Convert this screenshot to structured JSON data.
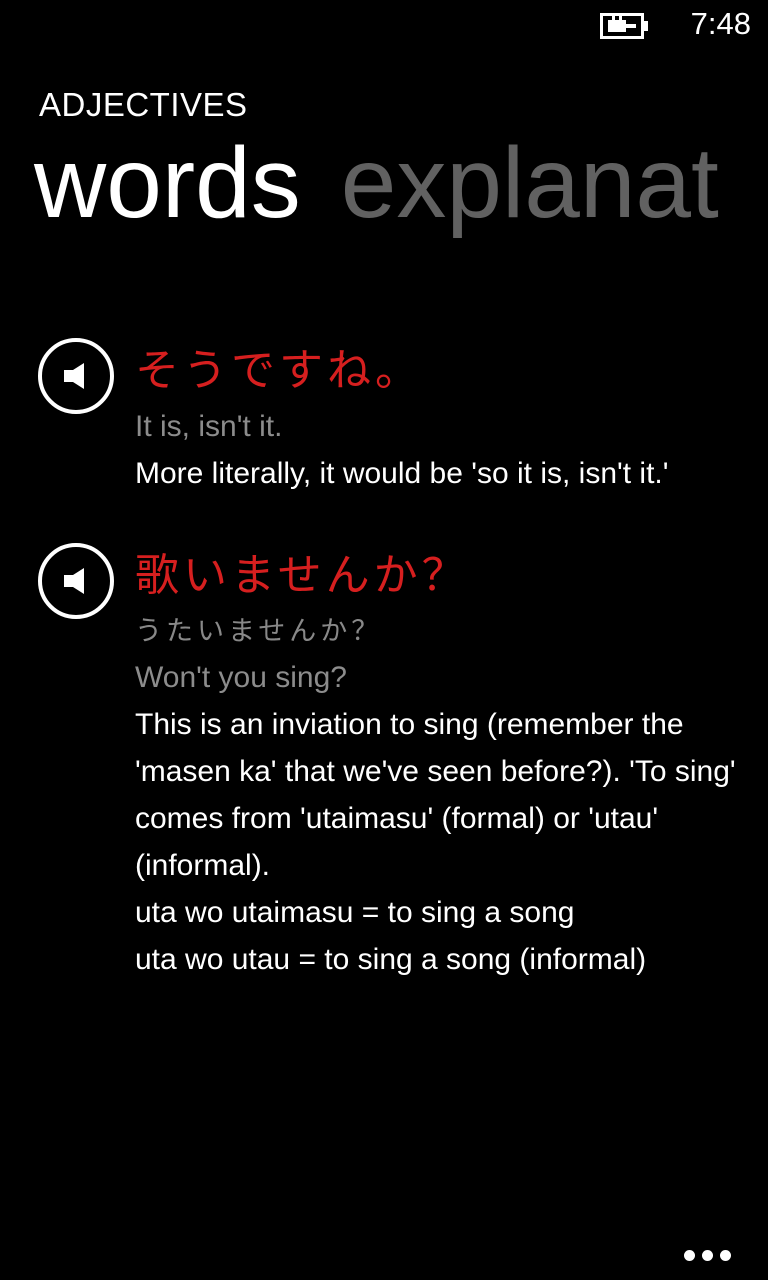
{
  "status_bar": {
    "time": "7:48",
    "battery_icon": "battery-charging-icon"
  },
  "header": {
    "app_title": "ADJECTIVES",
    "pivot_tabs": [
      {
        "label": "words",
        "active": true
      },
      {
        "label": "explanat",
        "active": false
      }
    ]
  },
  "entries": [
    {
      "japanese": "そうですね。",
      "reading": "",
      "translation": "It is, isn't it.",
      "explanation": "More literally, it would be 'so it is, isn't it.'"
    },
    {
      "japanese": "歌いませんか？",
      "reading": "うたいませんか？",
      "translation": "Won't you sing?",
      "explanation": "This is an inviation to sing (remember the 'masen ka' that we've seen before?). 'To sing' comes from 'utaimasu' (formal) or 'utau' (informal).\nuta wo utaimasu = to sing a song\nuta wo utau = to sing a song (informal)"
    }
  ],
  "colors": {
    "accent": "#d61f1f",
    "subtle_text": "#8c8c8c",
    "inactive_pivot": "#616161",
    "background": "#000000"
  },
  "icons": {
    "play_audio": "speaker-icon",
    "app_bar_more": "more-options-icon"
  }
}
